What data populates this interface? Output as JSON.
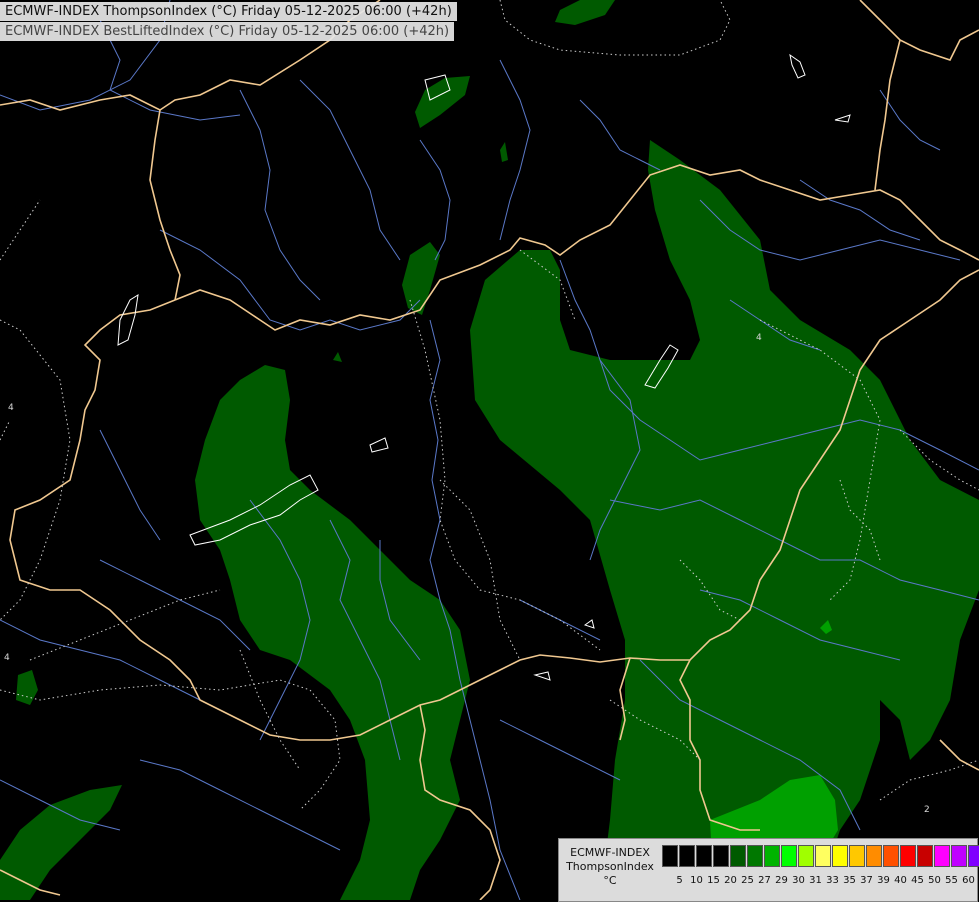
{
  "titles": {
    "line1": "ECMWF-INDEX ThompsonIndex (°C) Friday 05-12-2025 06:00 (+42h)",
    "line2": "ECMWF-INDEX BestLiftedIndex (°C) Friday 05-12-2025 06:00 (+42h)"
  },
  "map": {
    "contour_labels": [
      "4",
      "4",
      "4",
      "2"
    ],
    "colors": {
      "background": "#000000",
      "dark_green": "#005a00",
      "mid_green": "#00a000",
      "borders": "#f0c890",
      "rivers": "#6080d0",
      "contours": "#d8d8d8"
    }
  },
  "legend": {
    "line1": "ECMWF-INDEX",
    "line2": "ThompsonIndex",
    "line3": "°C",
    "levels": [
      "5",
      "10",
      "15",
      "20",
      "25",
      "27",
      "29",
      "30",
      "31",
      "33",
      "35",
      "37",
      "39",
      "40",
      "45",
      "50",
      "55",
      "60"
    ],
    "colors": [
      "#000000",
      "#000000",
      "#000000",
      "#000000",
      "#005a00",
      "#007800",
      "#00b400",
      "#00ff00",
      "#a0ff00",
      "#ffff60",
      "#ffff00",
      "#ffc800",
      "#ff8c00",
      "#ff5000",
      "#ff0000",
      "#c80000",
      "#ff00ff",
      "#c000ff",
      "#8000ff",
      "#0000ff"
    ]
  }
}
